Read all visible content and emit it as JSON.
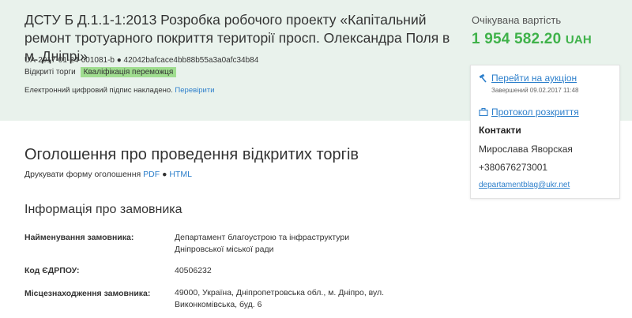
{
  "tender": {
    "title": "ДСТУ Б Д.1.1-1:2013 Розробка робочого проекту «Капітальний ремонт тротуарного покриття території просп. Олександра Поля в м. Дніпрі»",
    "id_line": "UA-2017-01-24-001081-b ● 42042bafcace4bb88b55a3a0afc34b84",
    "procedure": "Відкриті торги",
    "status": "Кваліфікація переможця",
    "signature_text": "Електронний цифровий підпис накладено.",
    "signature_link": "Перевірити"
  },
  "value": {
    "label": "Очікувана вартість",
    "amount": "1 954 582.20",
    "currency": "UAH"
  },
  "sidebar": {
    "auction_link": "Перейти на аукціон",
    "auction_status": "Завершений 09.02.2017 11:48",
    "protocol_link": "Протокол розкриття",
    "contacts_title": "Контакти",
    "contact_name": "Мирослава Яворская",
    "contact_phone": "+380676273001",
    "contact_email": "departamentblag@ukr.net"
  },
  "main": {
    "section_title": "Оголошення про проведення відкритих торгів",
    "print_label": "Друкувати форму оголошення",
    "print_pdf": "PDF",
    "print_sep": "●",
    "print_html": "HTML",
    "customer_title": "Інформація про замовника",
    "rows": [
      {
        "label": "Найменування замовника:",
        "value": "Департамент благоустрою та інфраструктури Дніпровської міської ради"
      },
      {
        "label": "Код ЄДРПОУ:",
        "value": "40506232"
      },
      {
        "label": "Місцезнаходження замовника:",
        "value": "49000, Україна, Дніпропетровська обл., м. Дніпро, вул. Виконкомівська, буд. 6"
      }
    ]
  },
  "colors": {
    "header_bg": "#e9f2ec",
    "amount": "#3fb24a",
    "link": "#2d7fcb",
    "badge": "#9fdd8f"
  }
}
